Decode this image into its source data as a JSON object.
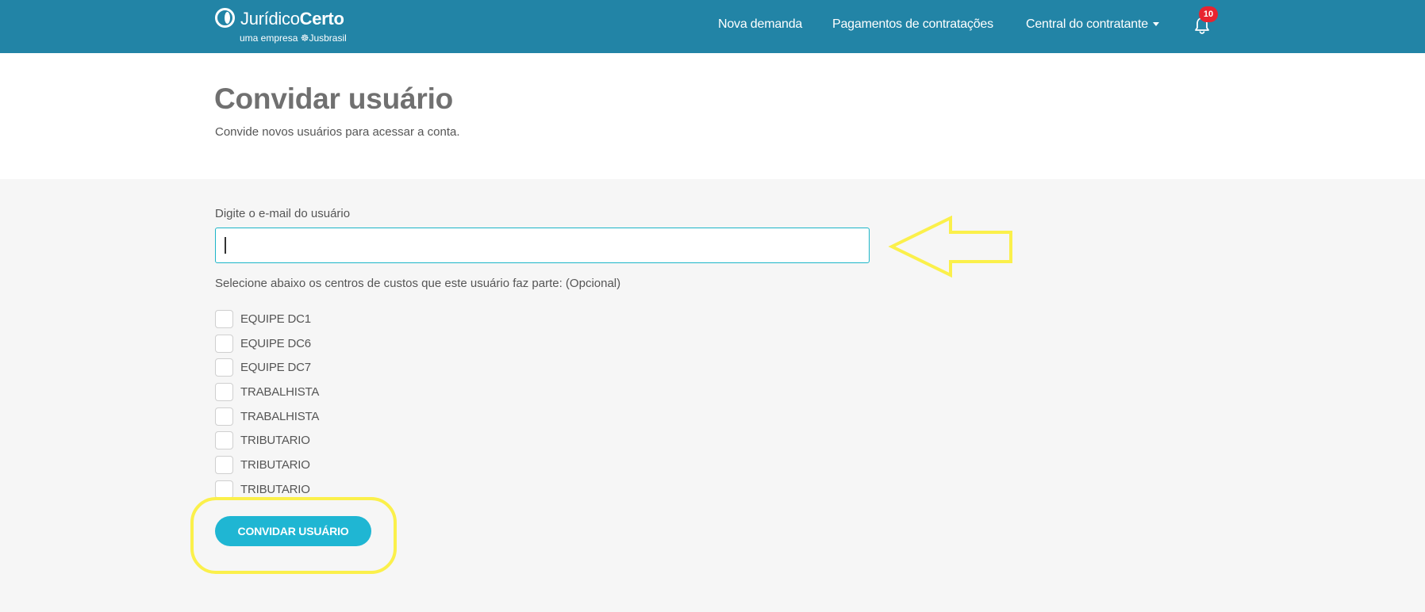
{
  "brand": {
    "name_regular": "Jurídico",
    "name_bold": "Certo",
    "tagline": "uma empresa ☸Jusbrasil"
  },
  "nav": {
    "items": [
      {
        "label": "Nova demanda"
      },
      {
        "label": "Pagamentos de contratações"
      },
      {
        "label": "Central do contratante"
      }
    ],
    "notifications_count": "10"
  },
  "page": {
    "title": "Convidar usuário",
    "subtitle": "Convide novos usuários para acessar a conta."
  },
  "form": {
    "email_label": "Digite o e-mail do usuário",
    "email_value": "",
    "cost_centers_label": "Selecione abaixo os centros de custos que este usuário faz parte: (Opcional)",
    "cost_centers": [
      {
        "label": "EQUIPE DC1",
        "checked": false
      },
      {
        "label": "EQUIPE DC6",
        "checked": false
      },
      {
        "label": "EQUIPE DC7",
        "checked": false
      },
      {
        "label": "TRABALHISTA",
        "checked": false
      },
      {
        "label": "TRABALHISTA",
        "checked": false
      },
      {
        "label": "TRIBUTARIO",
        "checked": false
      },
      {
        "label": "TRIBUTARIO",
        "checked": false
      },
      {
        "label": "TRIBUTARIO",
        "checked": false
      }
    ],
    "submit_label": "CONVIDAR USUÁRIO"
  },
  "colors": {
    "navbar": "#2284a6",
    "accent": "#1fb6d3",
    "badge": "#e8232f",
    "annotation": "#fbf04b"
  },
  "icons": [
    "logo-icon",
    "caret-down-icon",
    "bell-icon",
    "arrow-annotation-icon"
  ]
}
